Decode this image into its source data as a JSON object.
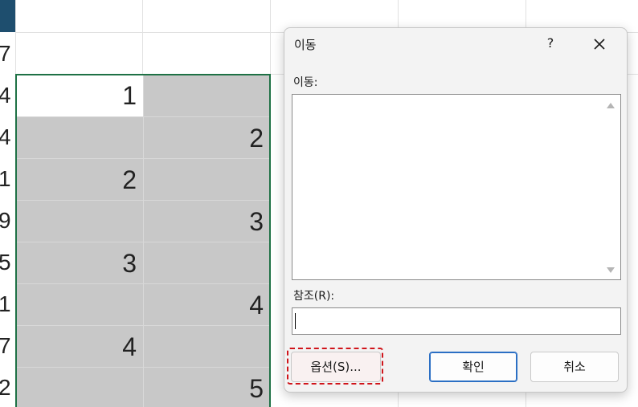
{
  "sheet": {
    "row_numbers": [
      "7",
      "4",
      "4",
      "1",
      "9",
      "5",
      "1",
      "7",
      "2"
    ],
    "cells": [
      {
        "col": 0,
        "row": 1,
        "value": "1"
      },
      {
        "col": 1,
        "row": 2,
        "value": "2"
      },
      {
        "col": 0,
        "row": 3,
        "value": "2"
      },
      {
        "col": 1,
        "row": 4,
        "value": "3"
      },
      {
        "col": 0,
        "row": 5,
        "value": "3"
      },
      {
        "col": 1,
        "row": 6,
        "value": "4"
      },
      {
        "col": 0,
        "row": 7,
        "value": "4"
      },
      {
        "col": 1,
        "row": 8,
        "value": "5"
      }
    ]
  },
  "dialog": {
    "title": "이동",
    "help_label": "?",
    "goto_label": "이동:",
    "goto_items": [],
    "reference_label": "참조(R):",
    "reference_value": "",
    "buttons": {
      "options": "옵션(S)...",
      "ok": "확인",
      "cancel": "취소"
    },
    "icons": {
      "close": "close-icon",
      "scroll_up": "scroll-up-icon",
      "scroll_down": "scroll-down-icon"
    },
    "colors": {
      "highlight": "#d0151b",
      "selection_border": "#1e7145",
      "ok_border": "#2b6fc4"
    }
  }
}
